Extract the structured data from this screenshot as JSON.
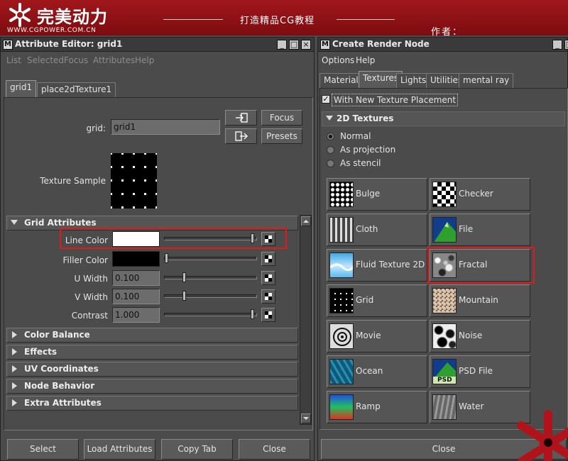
{
  "banner": {
    "brand": "完美动力",
    "url": "WWW.CGPOWER.COM.CN",
    "slogan": "打造精品CG教程",
    "author": "作者："
  },
  "attribute_editor": {
    "title": "Attribute Editor: grid1",
    "menu": [
      "List",
      "Selected",
      "Focus",
      "Attributes",
      "Help"
    ],
    "tabs": [
      "grid1",
      "place2dTexture1"
    ],
    "node_label": "grid:",
    "node_name": "grid1",
    "focus_label": "Focus",
    "presets_label": "Presets",
    "texture_sample_label": "Texture Sample",
    "grid_section": "Grid Attributes",
    "line_color_label": "Line Color",
    "filler_color_label": "Filler Color",
    "u_width_label": "U Width",
    "u_width_value": "0.100",
    "v_width_label": "V Width",
    "v_width_value": "0.100",
    "contrast_label": "Contrast",
    "contrast_value": "1.000",
    "collapsed_sections": [
      "Color Balance",
      "Effects",
      "UV Coordinates",
      "Node Behavior",
      "Extra Attributes"
    ],
    "buttons": [
      "Select",
      "Load Attributes",
      "Copy Tab",
      "Close"
    ]
  },
  "render_node": {
    "title": "Create Render Node",
    "menu": [
      "Options",
      "Help"
    ],
    "tabs": [
      "Materials",
      "Textures",
      "Lights",
      "Utilities",
      "mental ray"
    ],
    "placement_checkbox": "With New Texture Placement",
    "section": "2D Textures",
    "radios": [
      "Normal",
      "As projection",
      "As stencil"
    ],
    "nodes": [
      "Bulge",
      "Checker",
      "Cloth",
      "File",
      "Fluid Texture 2D",
      "Fractal",
      "Grid",
      "Mountain",
      "Movie",
      "Noise",
      "Ocean",
      "PSD File",
      "Ramp",
      "Water"
    ],
    "psd_badge": "PSD",
    "close_label": "Close"
  },
  "colors": {
    "banner_red": "#8f1216",
    "highlight_red": "#e01a1a",
    "line_color": "#ffffff",
    "filler_color": "#000000"
  }
}
